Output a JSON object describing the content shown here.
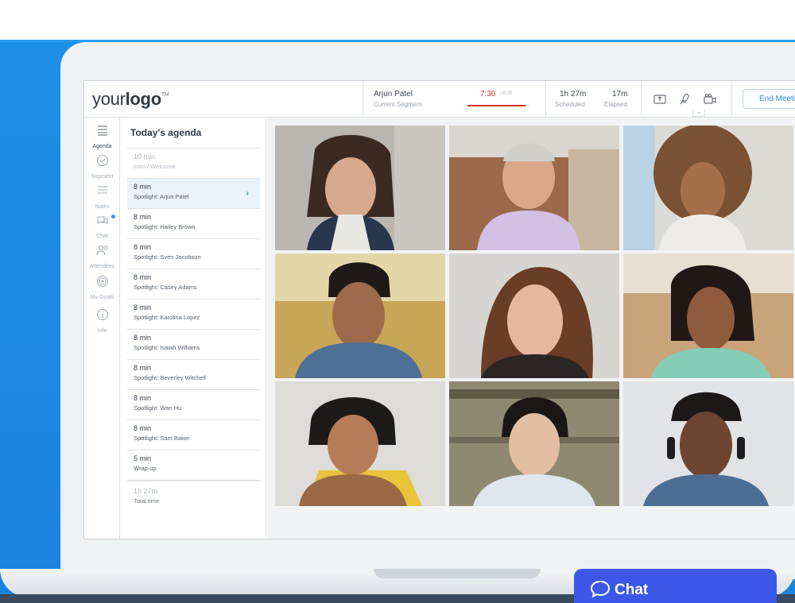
{
  "header": {
    "logo_text_light": "your",
    "logo_text_bold": "logo",
    "logo_tm": "TM",
    "current_speaker": "Arjun Patel",
    "current_segment_label": "Current Segment",
    "timer": "7:30",
    "timer_max": "/ 8:00",
    "timer_progress": 0.9375,
    "scheduled_value": "1h 27m",
    "scheduled_label": "Scheduled",
    "elapsed_value": "17m",
    "elapsed_label": "Elapsed",
    "end_button": "End Meeting",
    "caret": "⌄"
  },
  "nav": [
    {
      "label": "Agenda",
      "icon": "list-icon",
      "active": true
    },
    {
      "label": "Segment",
      "icon": "check-circle-icon",
      "active": false
    },
    {
      "label": "Notes",
      "icon": "notes-icon",
      "active": false
    },
    {
      "label": "Chat",
      "icon": "chat-bubbles-icon",
      "active": false
    },
    {
      "label": "Attendees",
      "icon": "people-icon",
      "active": false
    },
    {
      "label": "My Goals",
      "icon": "target-icon",
      "active": false
    },
    {
      "label": "Info",
      "icon": "info-icon",
      "active": false
    }
  ],
  "agenda": {
    "title": "Today's agenda",
    "items": [
      {
        "duration": "10 min",
        "label": "Intro / Welcome"
      },
      {
        "duration": "8 min",
        "label": "Spotlight: Arjun Patel"
      },
      {
        "duration": "8 min",
        "label": "Spotlight: Hailey Brown"
      },
      {
        "duration": "8 min",
        "label": "Spotlight: Sven Jacobson"
      },
      {
        "duration": "8 min",
        "label": "Spotlight: Casey Adams"
      },
      {
        "duration": "8 min",
        "label": "Spotlight: Karolina Lopez"
      },
      {
        "duration": "8 min",
        "label": "Spotlight: Isaiah Williams"
      },
      {
        "duration": "8 min",
        "label": "Spotlight: Beverley Witchell"
      },
      {
        "duration": "8 min",
        "label": "Spotlight: Wan Hu"
      },
      {
        "duration": "8 min",
        "label": "Spotlight: Sam Baker"
      },
      {
        "duration": "5 min",
        "label": "Wrap-up"
      }
    ],
    "total_value": "1h 27m",
    "total_label": "Total time",
    "active_chevron": "›"
  },
  "colors": {
    "accent": "#2b8be0",
    "timer_red": "#d0322f",
    "chat_button": "#3c57e8",
    "page_blue": "#1e8fe6"
  },
  "chat_button": {
    "label": "Chat",
    "icon": "chat-bubble-icon"
  }
}
